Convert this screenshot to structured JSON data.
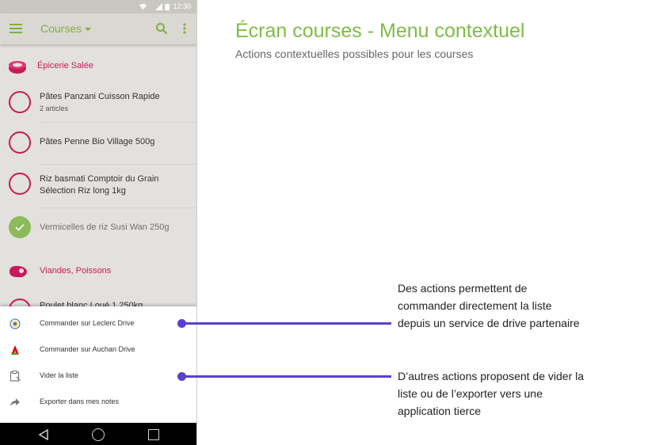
{
  "status_bar": {
    "time": "12:30"
  },
  "app_bar": {
    "title": "Courses"
  },
  "categories": [
    {
      "label": "Épicerie Salée",
      "icon": "can-icon"
    },
    {
      "label": "Viandes, Poissons",
      "icon": "meat-icon"
    }
  ],
  "items": [
    {
      "name": "Pâtes Panzani Cuisson Rapide",
      "sub": "2 articles",
      "checked": false
    },
    {
      "name": "Pâtes Penne Bio Village 500g",
      "checked": false
    },
    {
      "name": "Riz basmati Comptoir du Grain Sélection Riz long 1kg",
      "checked": false
    },
    {
      "name": "Vermicelles de riz Susi Wan 250g",
      "checked": true
    }
  ],
  "peek_item": "Poulet blanc Loué 1,250kg",
  "actions": [
    {
      "label": "Commander sur Leclerc Drive",
      "icon": "leclerc-logo-icon"
    },
    {
      "label": "Commander sur Auchan Drive",
      "icon": "auchan-logo-icon"
    },
    {
      "label": "Vider la liste",
      "icon": "clear-list-icon"
    },
    {
      "label": "Exporter dans mes notes",
      "icon": "share-arrow-icon"
    }
  ],
  "annotation": {
    "title": "Écran courses - Menu contextuel",
    "subtitle": "Actions contextuelles possibles pour les courses",
    "callouts": [
      {
        "lines": [
          "Des actions permettent de",
          "commander directement la liste",
          "depuis un service de drive partenaire"
        ]
      },
      {
        "lines": [
          "D’autres actions proposent de vider la",
          "liste ou de l’exporter vers une",
          "application tierce"
        ]
      }
    ]
  },
  "colors": {
    "accent_green": "#7fae3f",
    "category_pink": "#c8195a",
    "callout_purple": "#5a3fd0"
  }
}
